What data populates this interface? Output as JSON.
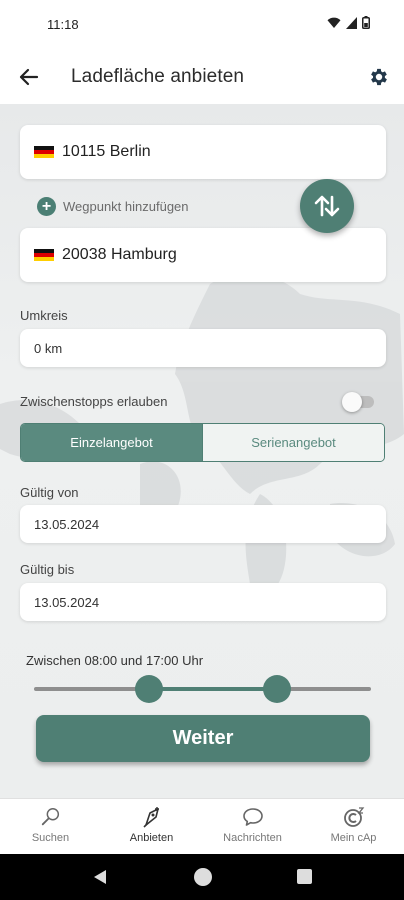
{
  "status": {
    "time": "11:18"
  },
  "header": {
    "title": "Ladefläche anbieten"
  },
  "route": {
    "origin": "10115 Berlin",
    "destination": "20038 Hamburg",
    "add_waypoint_label": "Wegpunkt hinzufügen"
  },
  "radius": {
    "label": "Umkreis",
    "value": "0 km"
  },
  "stops": {
    "label": "Zwischenstopps erlauben",
    "enabled": false
  },
  "offer_type": {
    "options": [
      "Einzelangebot",
      "Serienangebot"
    ],
    "selected": "Einzelangebot"
  },
  "valid_from": {
    "label": "Gültig von",
    "value": "13.05.2024"
  },
  "valid_to": {
    "label": "Gültig bis",
    "value": "13.05.2024"
  },
  "time_window": {
    "label": "Zwischen 08:00 und 17:00 Uhr",
    "start_fraction": 0.34,
    "end_fraction": 0.72
  },
  "actions": {
    "continue_label": "Weiter"
  },
  "bottom_nav": {
    "items": [
      {
        "label": "Suchen",
        "icon": "search-icon"
      },
      {
        "label": "Anbieten",
        "icon": "offer-icon"
      },
      {
        "label": "Nachrichten",
        "icon": "chat-icon"
      },
      {
        "label": "Mein cAp",
        "icon": "account-icon"
      }
    ]
  },
  "colors": {
    "accent": "#4f7f74",
    "accent_light": "#5a8a7f",
    "background": "#eceeee"
  }
}
